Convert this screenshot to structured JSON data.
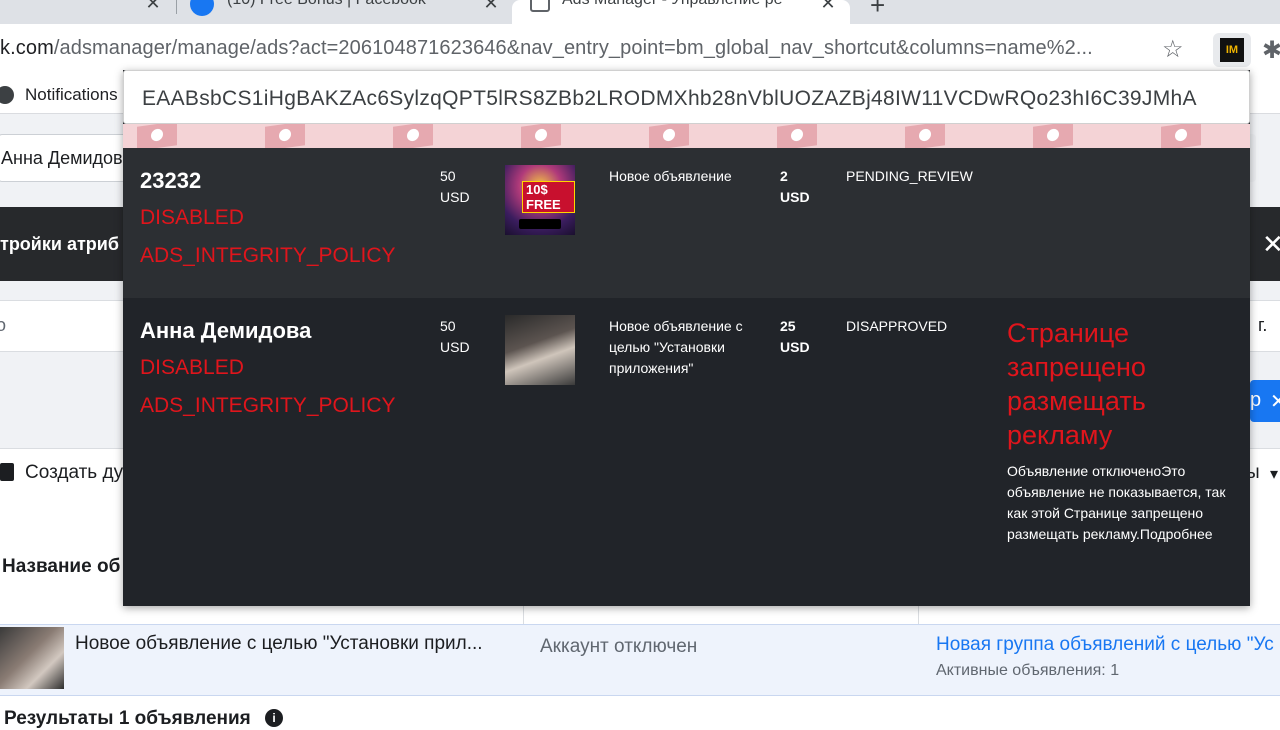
{
  "browser": {
    "tabs": [
      {
        "title": "",
        "active": false
      },
      {
        "title": "(10) Free Bonus | Facebook",
        "active": false
      },
      {
        "title": "Ads Manager - Управление ре",
        "active": true
      }
    ],
    "url_domain": "k.com",
    "url_path": "/adsmanager/manage/ads?act=206104871623646&nav_entry_point=bm_global_nav_shortcut&columns=name%2...",
    "bookmark": "Notifications"
  },
  "page": {
    "account_select": "Анна Демидова",
    "dark_band_text": "тройки атриб",
    "input_right": "г.",
    "blue_btn_text": "р",
    "create_copy": "Создать ду",
    "toolbar_right": "ы",
    "column_name_header": "Название об",
    "ad_row": {
      "name": "Новое объявление с целью \"Установки прил...",
      "status": "Аккаунт отключен",
      "group": "Новая группа объявлений с целью \"Ус",
      "group_sub": "Активные объявления: 1"
    },
    "results_label": "Результаты 1 объявления"
  },
  "overlay": {
    "token": "EAABsbCS1iHgBAKZAc6SylzqQPT5lRS8ZBb2LRODMXhb28nVblUOZAZBj48IW11VCDwRQo23hI6C39JMhA",
    "rows": [
      {
        "account_name": "23232",
        "account_status": "DISABLED",
        "disable_reason": "ADS_INTEGRITY_POLICY",
        "budget_amount": "50",
        "budget_currency": "USD",
        "ad_name": "Новое объявление",
        "spend_amount": "2",
        "spend_currency": "USD",
        "review_status": "PENDING_REVIEW",
        "thumbnail_badge": "10$ FREE"
      },
      {
        "account_name": "Анна Демидова",
        "account_status": "DISABLED",
        "disable_reason": "ADS_INTEGRITY_POLICY",
        "budget_amount": "50",
        "budget_currency": "USD",
        "ad_name": "Новое объявление с целью \"Установки приложения\"",
        "spend_amount": "25",
        "spend_currency": "USD",
        "review_status": "DISAPPROVED",
        "rejection_title": "Странице запрещено размещать рекламу",
        "rejection_description": "Объявление отключеноЭто объявление не показывается, так как этой Странице запрещено размещать рекламу.Подробнее"
      }
    ]
  },
  "colors": {
    "overlay_bg": "#25282c",
    "error_red": "#e0151c",
    "fb_blue": "#1877f2"
  }
}
